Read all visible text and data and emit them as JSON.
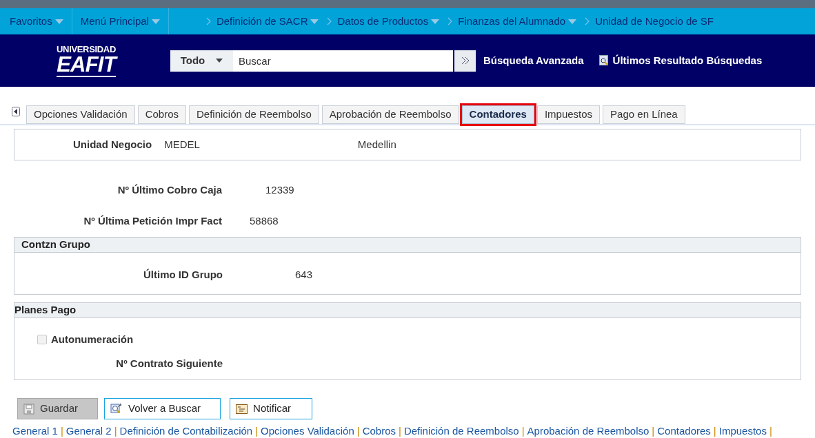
{
  "menu_bar": {
    "items": [
      {
        "label": "Favoritos",
        "kind": "menu"
      },
      {
        "label": "Menú Principal",
        "kind": "menu"
      },
      {
        "label": "Definición de SACR",
        "kind": "crumb_menu"
      },
      {
        "label": "Datos de Productos",
        "kind": "crumb_menu"
      },
      {
        "label": "Finanzas del Alumnado",
        "kind": "crumb_menu"
      },
      {
        "label": "Unidad de Negocio de SF",
        "kind": "crumb"
      }
    ]
  },
  "header": {
    "logo_top": "UNIVERSIDAD",
    "logo_main": "EAFIT",
    "search_scope": "Todo",
    "search_placeholder": "Buscar",
    "advanced_search": "Búsqueda Avanzada",
    "recent_results": "Últimos Resultado Búsquedas"
  },
  "tabs": [
    {
      "label": "Opciones Validación",
      "selected": false
    },
    {
      "label": "Cobros",
      "selected": false
    },
    {
      "label": "Definición de Reembolso",
      "selected": false
    },
    {
      "label": "Aprobación de Reembolso",
      "selected": false
    },
    {
      "label": "Contadores",
      "selected": true
    },
    {
      "label": "Impuestos",
      "selected": false
    },
    {
      "label": "Pago en Línea",
      "selected": false
    }
  ],
  "business_unit": {
    "label": "Unidad Negocio",
    "code": "MEDEL",
    "description": "Medellin"
  },
  "counters": [
    {
      "label": "Nº Último Cobro Caja",
      "value": "12339"
    },
    {
      "label": "Nº Última Petición Impr Fact",
      "value": "58868"
    }
  ],
  "group_section": {
    "title": "Contzn Grupo",
    "label": "Último ID Grupo",
    "value": "643"
  },
  "plans_section": {
    "title": "Planes Pago",
    "checkbox": {
      "label": "Autonumeración",
      "checked": false,
      "disabled": true
    },
    "next_contract_label": "Nº Contrato Siguiente"
  },
  "buttons": [
    {
      "label": "Guardar",
      "kind": "save",
      "disabled": true
    },
    {
      "label": "Volver a Buscar",
      "kind": "return",
      "disabled": false
    },
    {
      "label": "Notificar",
      "kind": "notify",
      "disabled": false
    }
  ],
  "footer_links": {
    "separator": "|",
    "items": [
      "General 1",
      "General 2",
      "Definición de Contabilización",
      "Opciones Validación",
      "Cobros",
      "Definición de Reembolso",
      "Aprobación de Reembolso",
      "Contadores",
      "Impuestos"
    ]
  }
}
